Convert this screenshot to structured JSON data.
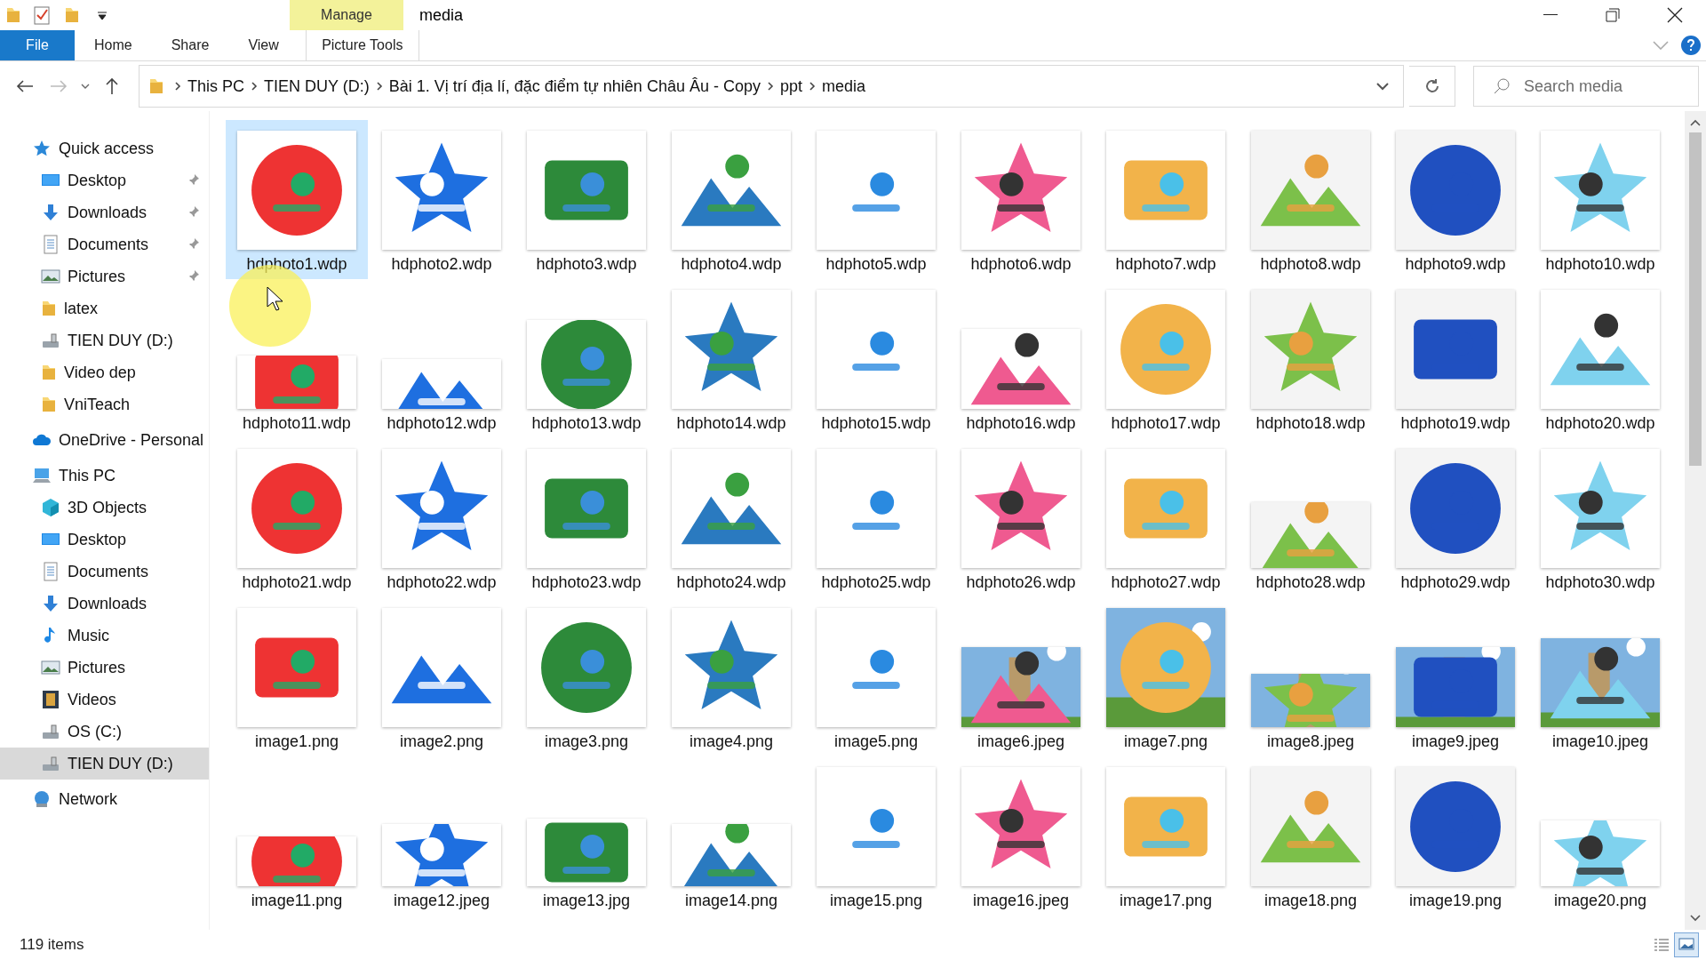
{
  "window": {
    "title": "media"
  },
  "quick_toolbar": {
    "buttons": [
      {
        "kind": "properties"
      },
      {
        "kind": "new-folder"
      },
      {
        "kind": "customize"
      }
    ]
  },
  "ribbon": {
    "tabs": [
      {
        "label": "File",
        "kind": "file"
      },
      {
        "label": "Home",
        "kind": "tab"
      },
      {
        "label": "Share",
        "kind": "tab"
      },
      {
        "label": "View",
        "kind": "tab"
      }
    ],
    "contextual": {
      "group": "Manage",
      "label": "Picture Tools"
    }
  },
  "address": {
    "path": [
      "This PC",
      "TIEN DUY (D:)",
      "Bài 1. Vị trí địa lí, đặc điểm tự nhiên Châu Âu - Copy",
      "ppt",
      "media"
    ]
  },
  "search": {
    "placeholder": "Search media"
  },
  "sidebar": [
    {
      "label": "Quick access",
      "kind": "star",
      "selected": false,
      "children": [
        {
          "label": "Desktop",
          "kind": "desktop",
          "pinned": true,
          "selected": false
        },
        {
          "label": "Downloads",
          "kind": "download",
          "pinned": true,
          "selected": false
        },
        {
          "label": "Documents",
          "kind": "document",
          "pinned": true,
          "selected": false
        },
        {
          "label": "Pictures",
          "kind": "pictures",
          "pinned": true,
          "selected": false
        },
        {
          "label": "latex",
          "kind": "folder",
          "pinned": false,
          "selected": false
        },
        {
          "label": "TIEN DUY (D:)",
          "kind": "drive",
          "pinned": false,
          "selected": false
        },
        {
          "label": "Video dep",
          "kind": "folder",
          "pinned": false,
          "selected": false
        },
        {
          "label": "VniTeach",
          "kind": "folder",
          "pinned": false,
          "selected": false
        }
      ]
    },
    {
      "label": "OneDrive - Personal",
      "kind": "cloud",
      "selected": false
    },
    {
      "label": "This PC",
      "kind": "pc",
      "selected": false,
      "children": [
        {
          "label": "3D Objects",
          "kind": "cube",
          "pinned": false,
          "selected": false
        },
        {
          "label": "Desktop",
          "kind": "desktop",
          "pinned": false,
          "selected": false
        },
        {
          "label": "Documents",
          "kind": "document",
          "pinned": false,
          "selected": false
        },
        {
          "label": "Downloads",
          "kind": "download",
          "pinned": false,
          "selected": false
        },
        {
          "label": "Music",
          "kind": "music",
          "pinned": false,
          "selected": false
        },
        {
          "label": "Pictures",
          "kind": "pictures",
          "pinned": false,
          "selected": false
        },
        {
          "label": "Videos",
          "kind": "videos",
          "pinned": false,
          "selected": false
        },
        {
          "label": "OS (C:)",
          "kind": "drive",
          "pinned": false,
          "selected": false
        },
        {
          "label": "TIEN DUY (D:)",
          "kind": "drive",
          "pinned": false,
          "selected": true
        }
      ]
    },
    {
      "label": "Network",
      "kind": "network",
      "selected": false
    }
  ],
  "files": [
    {
      "name": "hdphoto1.wdp",
      "selected": true
    },
    {
      "name": "hdphoto2.wdp",
      "selected": false
    },
    {
      "name": "hdphoto3.wdp",
      "selected": false
    },
    {
      "name": "hdphoto4.wdp",
      "selected": false
    },
    {
      "name": "hdphoto5.wdp",
      "selected": false
    },
    {
      "name": "hdphoto6.wdp",
      "selected": false
    },
    {
      "name": "hdphoto7.wdp",
      "selected": false
    },
    {
      "name": "hdphoto8.wdp",
      "selected": false
    },
    {
      "name": "hdphoto9.wdp",
      "selected": false
    },
    {
      "name": "hdphoto10.wdp",
      "selected": false
    },
    {
      "name": "hdphoto11.wdp",
      "selected": false
    },
    {
      "name": "hdphoto12.wdp",
      "selected": false
    },
    {
      "name": "hdphoto13.wdp",
      "selected": false
    },
    {
      "name": "hdphoto14.wdp",
      "selected": false
    },
    {
      "name": "hdphoto15.wdp",
      "selected": false
    },
    {
      "name": "hdphoto16.wdp",
      "selected": false
    },
    {
      "name": "hdphoto17.wdp",
      "selected": false
    },
    {
      "name": "hdphoto18.wdp",
      "selected": false
    },
    {
      "name": "hdphoto19.wdp",
      "selected": false
    },
    {
      "name": "hdphoto20.wdp",
      "selected": false
    },
    {
      "name": "hdphoto21.wdp",
      "selected": false
    },
    {
      "name": "hdphoto22.wdp",
      "selected": false
    },
    {
      "name": "hdphoto23.wdp",
      "selected": false
    },
    {
      "name": "hdphoto24.wdp",
      "selected": false
    },
    {
      "name": "hdphoto25.wdp",
      "selected": false
    },
    {
      "name": "hdphoto26.wdp",
      "selected": false
    },
    {
      "name": "hdphoto27.wdp",
      "selected": false
    },
    {
      "name": "hdphoto28.wdp",
      "selected": false
    },
    {
      "name": "hdphoto29.wdp",
      "selected": false
    },
    {
      "name": "hdphoto30.wdp",
      "selected": false
    },
    {
      "name": "image1.png",
      "selected": false
    },
    {
      "name": "image2.png",
      "selected": false
    },
    {
      "name": "image3.png",
      "selected": false
    },
    {
      "name": "image4.png",
      "selected": false
    },
    {
      "name": "image5.png",
      "selected": false
    },
    {
      "name": "image6.jpeg",
      "selected": false
    },
    {
      "name": "image7.png",
      "selected": false
    },
    {
      "name": "image8.jpeg",
      "selected": false
    },
    {
      "name": "image9.jpeg",
      "selected": false
    },
    {
      "name": "image10.jpeg",
      "selected": false
    },
    {
      "name": "image11.png",
      "selected": false
    },
    {
      "name": "image12.jpeg",
      "selected": false
    },
    {
      "name": "image13.jpg",
      "selected": false
    },
    {
      "name": "image14.png",
      "selected": false
    },
    {
      "name": "image15.png",
      "selected": false
    },
    {
      "name": "image16.jpeg",
      "selected": false
    },
    {
      "name": "image17.png",
      "selected": false
    },
    {
      "name": "image18.png",
      "selected": false
    },
    {
      "name": "image19.png",
      "selected": false
    },
    {
      "name": "image20.png",
      "selected": false
    }
  ],
  "status_bar": {
    "count": "119 items",
    "views": [
      {
        "kind": "details",
        "selected": false
      },
      {
        "kind": "large-icons",
        "selected": true
      }
    ]
  }
}
